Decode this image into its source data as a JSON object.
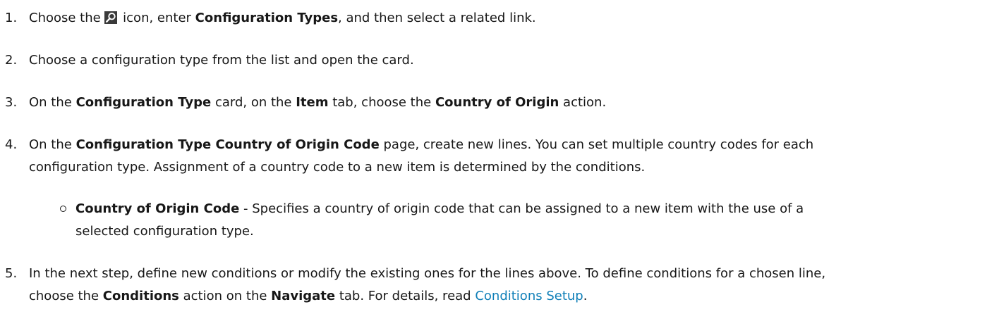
{
  "steps": [
    {
      "number": "1.",
      "parts": [
        "Choose the ",
        " icon, enter ",
        "Configuration Types",
        ", and then select a related link."
      ]
    },
    {
      "number": "2.",
      "parts": [
        "Choose a configuration type from the list and open the card."
      ]
    },
    {
      "number": "3.",
      "parts": [
        "On the ",
        "Configuration Type",
        " card, on the ",
        "Item",
        " tab, choose the ",
        "Country of Origin",
        " action."
      ]
    },
    {
      "number": "4.",
      "line1": [
        "On the ",
        "Configuration Type Country of Origin Code",
        " page, create new lines. You can set multiple country codes for each"
      ],
      "line2": "configuration type. Assignment of a country code to a new item is determined by the conditions."
    },
    {
      "number": "5.",
      "line1": "In the next step, define new conditions or modify the existing ones for the lines above. To define conditions for a chosen line,",
      "line2": [
        "choose the ",
        "Conditions",
        " action on the ",
        "Navigate",
        " tab. For details, read ",
        "Conditions Setup",
        "."
      ]
    }
  ],
  "sub_bullet": {
    "term": "Country of Origin Code",
    "line1": " - Specifies a country of origin code that can be assigned to a new item with the use of a",
    "line2": "selected configuration type."
  },
  "icons": {
    "search": "search-icon"
  },
  "colors": {
    "text": "#171717",
    "link": "#0f7fb8",
    "icon_bg": "#3a3a3a"
  }
}
